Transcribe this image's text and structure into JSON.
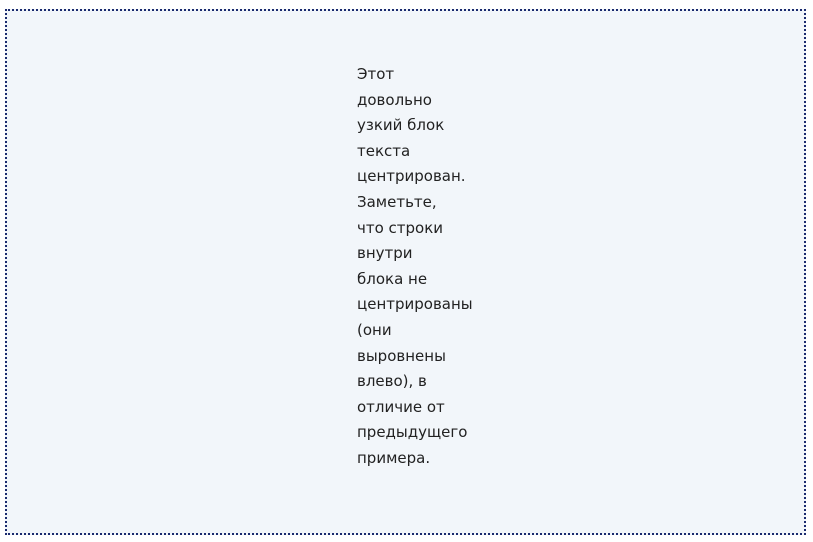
{
  "block": {
    "lines": [
      "Этот",
      "довольно",
      "узкий блок",
      "текста",
      "центрирован.",
      "Заметьте,",
      "что строки",
      "внутри",
      "блока не",
      "центрированы",
      "(они",
      "выровнены",
      "влево), в",
      "отличие от",
      "предыдущего",
      "примера."
    ]
  },
  "colors": {
    "background": "#f2f6fa",
    "border": "#1a2a6e",
    "text": "#222222"
  }
}
